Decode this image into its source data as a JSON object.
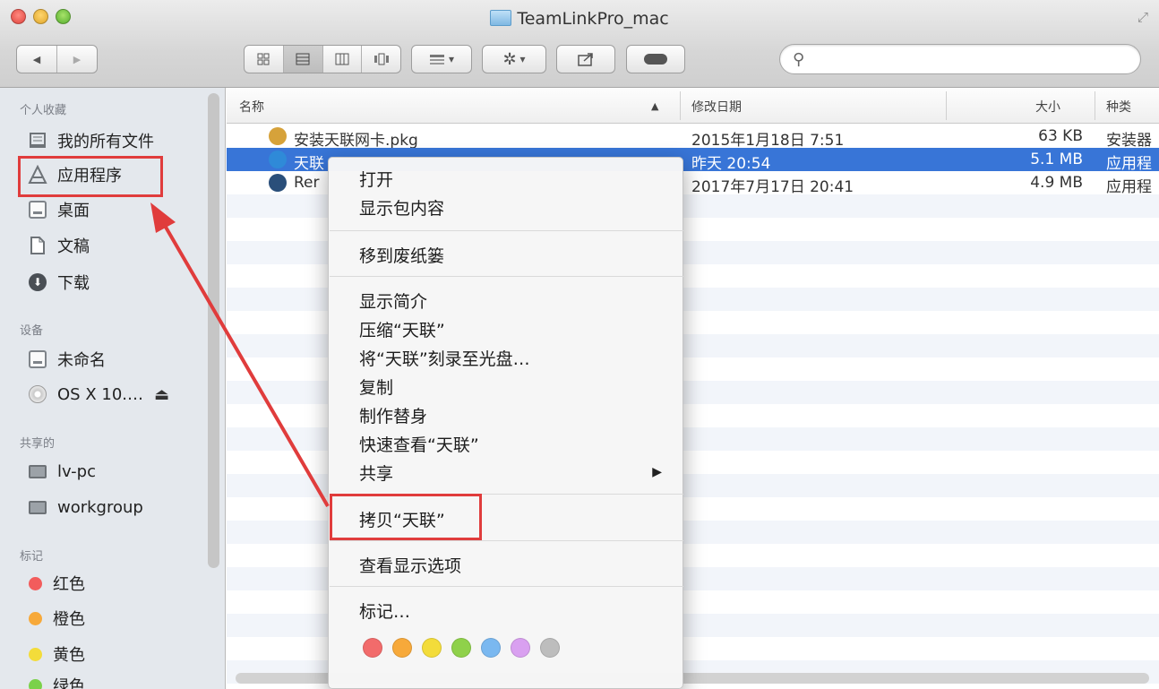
{
  "window": {
    "title": "TeamLinkPro_mac"
  },
  "toolbar": {
    "back_glyph": "◀",
    "forward_glyph": "▶",
    "view_icons": [
      "icon-view-icon",
      "list-view-icon",
      "column-view-icon",
      "coverflow-view-icon"
    ],
    "arrange_glyph": "▾",
    "action_glyph": "▾",
    "search": {
      "placeholder": "",
      "value": ""
    }
  },
  "sidebar": {
    "favorites_heading": "个人收藏",
    "favorites": [
      "我的所有文件",
      "应用程序",
      "桌面",
      "文稿",
      "下载"
    ],
    "devices_heading": "设备",
    "devices": [
      "未命名",
      "OS X 10.…"
    ],
    "eject_glyph": "⏏",
    "shared_heading": "共享的",
    "shared": [
      "lv-pc",
      "workgroup"
    ],
    "tags_heading": "标记",
    "tags": [
      {
        "label": "红色",
        "color": "#f25c5c"
      },
      {
        "label": "橙色",
        "color": "#f7a93a"
      },
      {
        "label": "黄色",
        "color": "#f3dc3a"
      },
      {
        "label": "绿色",
        "color": "#7bd14a"
      }
    ]
  },
  "list": {
    "columns": {
      "name": "名称",
      "sort_glyph": "▲",
      "modified": "修改日期",
      "size": "大小",
      "kind": "种类"
    },
    "rows": [
      {
        "name": "安装天联网卡.pkg",
        "modified": "2015年1月18日 7:51",
        "size": "63 KB",
        "kind": "安装器"
      },
      {
        "name": "天联",
        "modified": "昨天 20:54",
        "size": "5.1 MB",
        "kind": "应用程"
      },
      {
        "name": "Rer",
        "modified": "2017年7月17日 20:41",
        "size": "4.9 MB",
        "kind": "应用程"
      }
    ]
  },
  "context_menu": {
    "open": "打开",
    "show_package": "显示包内容",
    "trash": "移到废纸篓",
    "get_info": "显示简介",
    "compress": "压缩“天联”",
    "burn": "将“天联”刻录至光盘…",
    "duplicate": "复制",
    "make_alias": "制作替身",
    "quick_look": "快速查看“天联”",
    "share": "共享",
    "share_arrow": "▶",
    "copy": "拷贝“天联”",
    "view_options": "查看显示选项",
    "tags": "标记…",
    "tag_colors": [
      "#f26b6b",
      "#f7a93a",
      "#f3dc3a",
      "#8fd14a",
      "#7ab8f0",
      "#d9a0f0",
      "#bdbdbd"
    ]
  },
  "annotations": {
    "highlight_color": "#e03c3c"
  }
}
